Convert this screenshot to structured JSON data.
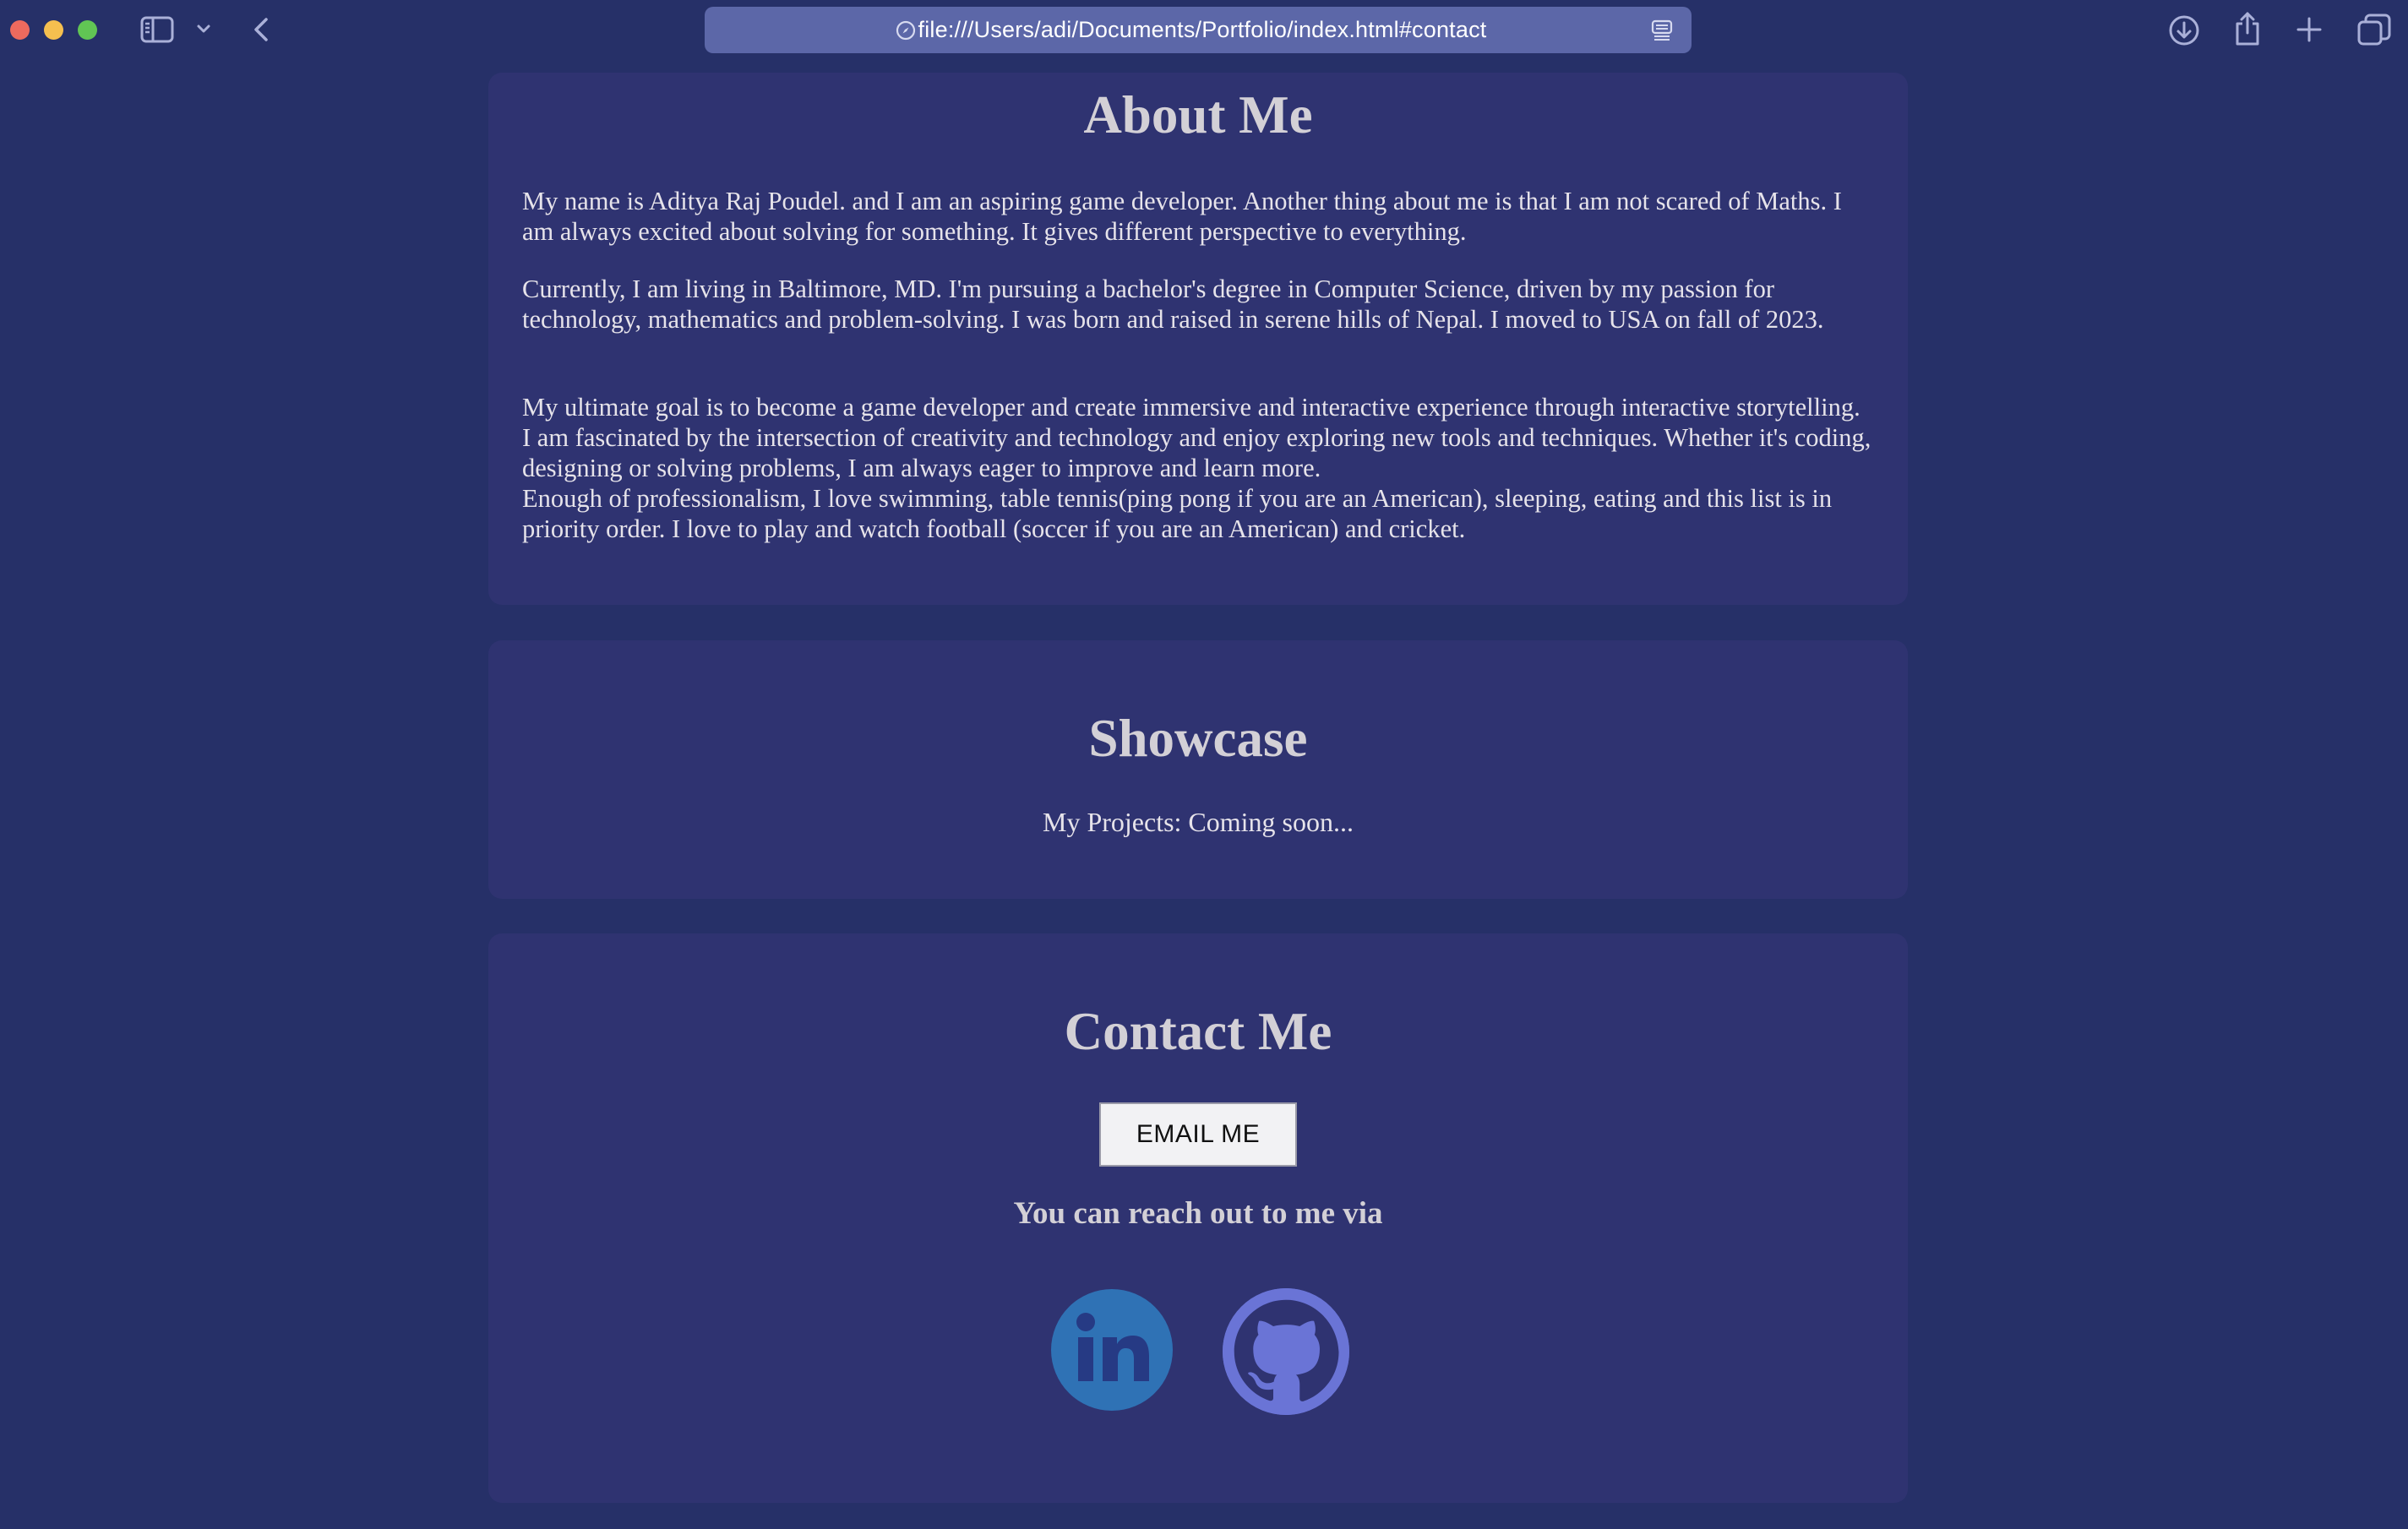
{
  "browser": {
    "url": "file:///Users/adi/Documents/Portfolio/index.html#contact",
    "icons": {
      "sidebar": "sidebar-icon",
      "tab_group": "chevron-down-icon",
      "back": "chevron-left-icon",
      "site_info": "compass-icon",
      "reader": "reader-icon",
      "downloads": "download-icon",
      "share": "share-icon",
      "new_tab": "plus-icon",
      "tab_overview": "tabs-icon"
    }
  },
  "about": {
    "heading": "About Me",
    "paragraph_1": "My name is Aditya Raj Poudel. and I am an aspiring game developer. Another thing about me is that I am not scared of Maths. I am always excited about solving for something. It gives different perspective to everything.",
    "paragraph_2": "Currently, I am living in Baltimore, MD. I'm pursuing a bachelor's degree in Computer Science, driven by my passion for technology, mathematics and problem-solving. I was born and raised in serene hills of Nepal. I moved to USA on fall of 2023.",
    "paragraph_3a": "My ultimate goal is to become a game developer and create immersive and interactive experience through interactive storytelling. I am fascinated by the intersection of creativity and technology and enjoy exploring new tools and techniques. Whether it's coding, designing or solving problems, I am always eager to improve and learn more.",
    "paragraph_3b": "Enough of professionalism, I love swimming, table tennis(ping pong if you are an American), sleeping, eating and this list is in priority order. I love to play and watch football (soccer if you are an American) and cricket."
  },
  "showcase": {
    "heading": "Showcase",
    "text": "My Projects: Coming soon..."
  },
  "contact": {
    "heading": "Contact Me",
    "email_button": "EMAIL ME",
    "reach_text": "You can reach out to me via",
    "linkedin_icon": "linkedin-icon",
    "github_icon": "github-icon"
  },
  "colors": {
    "page_background": "#263068",
    "card_background": "#2f3371",
    "heading_text": "#d3d0d6",
    "body_text": "#e6e3ea",
    "linkedin": "#2f72b5",
    "github": "#6a74d6"
  }
}
